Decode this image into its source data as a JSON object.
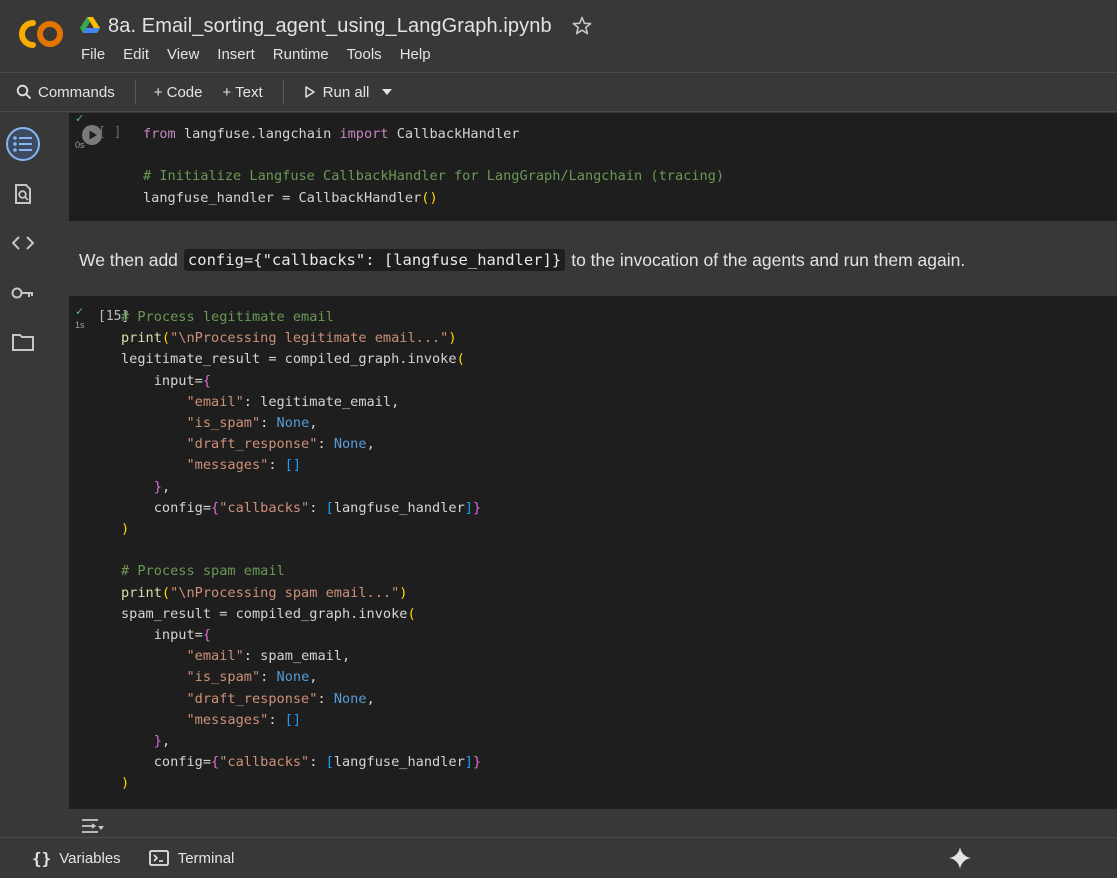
{
  "header": {
    "title": "8a. Email_sorting_agent_using_LangGraph.ipynb",
    "menu": [
      "File",
      "Edit",
      "View",
      "Insert",
      "Runtime",
      "Tools",
      "Help"
    ]
  },
  "toolbar": {
    "commands": "Commands",
    "code": "+ Code",
    "text": "+ Text",
    "run_all": "Run all"
  },
  "cells": [
    {
      "exec_count": "[ ]",
      "exec_time": "0s",
      "status": "✓"
    },
    {
      "text_before": "We then add",
      "inline_code": "config={\"callbacks\": [langfuse_handler]}",
      "text_after": "to the invocation of the agents and run them again."
    },
    {
      "exec_count": "[15]",
      "exec_time": "1s",
      "status": "✓"
    }
  ],
  "statusbar": {
    "variables": "Variables",
    "terminal": "Terminal"
  },
  "colors": {
    "background": "#383838",
    "cell": "#1e1e1e",
    "accent": "#8ab4f8",
    "success": "#5bb974",
    "logo_orange": "#f9ab00",
    "logo_dark": "#e37400"
  }
}
